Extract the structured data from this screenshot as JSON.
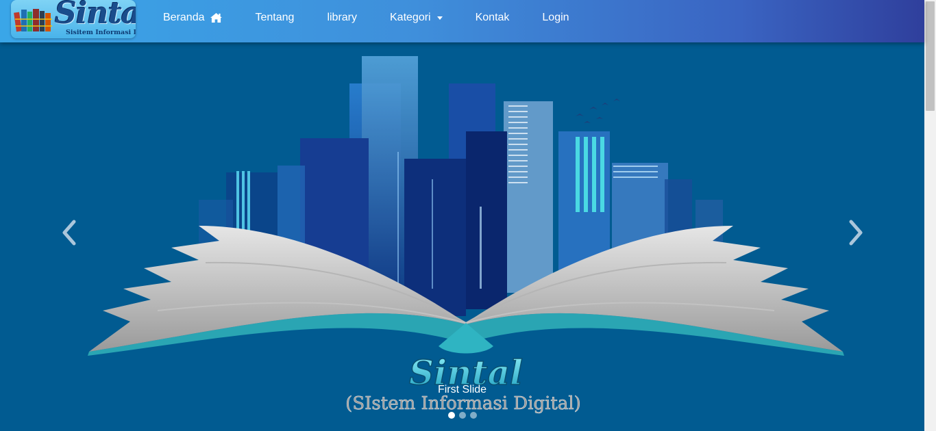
{
  "brand": {
    "name": "Sintal",
    "subtitle": "Sisitem Informasi Digital"
  },
  "nav": {
    "items": [
      {
        "label": "Beranda",
        "icon": "home-icon"
      },
      {
        "label": "Tentang"
      },
      {
        "label": "library"
      },
      {
        "label": "Kategori",
        "dropdown": true
      },
      {
        "label": "Kontak"
      },
      {
        "label": "Login"
      }
    ]
  },
  "carousel": {
    "caption": "First Slide",
    "artwork_title": "Sintal",
    "artwork_subtitle": "(SIstem Informasi Digital)",
    "slide_count": 3,
    "active_index": 0
  },
  "colors": {
    "navbar_start": "#3aa6e8",
    "navbar_end": "#2f3f9c",
    "slide_background": "#015b91",
    "book_accent": "#2aa5b3"
  }
}
